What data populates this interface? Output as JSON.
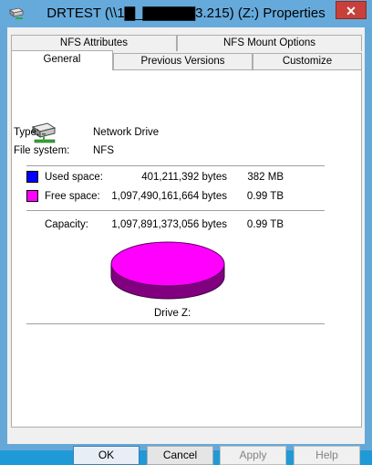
{
  "window": {
    "title": "DRTEST (\\\\1▇_▇▇▇▇▇3.215) (Z:) Properties",
    "close_glyph": "✕"
  },
  "tabs": {
    "row1": [
      {
        "label": "NFS Attributes"
      },
      {
        "label": "NFS Mount Options"
      }
    ],
    "row2": [
      {
        "label": "General",
        "active": true
      },
      {
        "label": "Previous Versions"
      },
      {
        "label": "Customize"
      }
    ]
  },
  "general": {
    "drive_icon": "network-drive-icon",
    "type_label": "Type:",
    "type_value": "Network Drive",
    "fs_label": "File system:",
    "fs_value": "NFS",
    "used_label": "Used space:",
    "used_bytes": "401,211,392 bytes",
    "used_size": "382 MB",
    "used_color": "#0000ff",
    "free_label": "Free space:",
    "free_bytes": "1,097,490,161,664 bytes",
    "free_size": "0.99 TB",
    "free_color": "#ff00ff",
    "capacity_label": "Capacity:",
    "capacity_bytes": "1,097,891,373,056 bytes",
    "capacity_size": "0.99 TB",
    "drive_label": "Drive Z:"
  },
  "buttons": {
    "ok": "OK",
    "cancel": "Cancel",
    "apply": "Apply",
    "help": "Help"
  }
}
